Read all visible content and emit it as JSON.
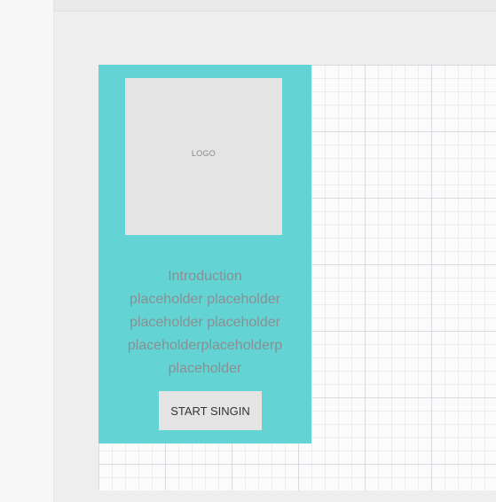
{
  "screen": {
    "logo_placeholder": "LOGO",
    "intro_lines": [
      "Introduction",
      "placeholder placeholder",
      "placeholder placeholder",
      "placeholderplaceholderp",
      "placeholder"
    ],
    "start_button_label": "START SINGIN"
  },
  "colors": {
    "screen_background": "#63d3d3",
    "placeholder_gray": "#e4e4e4",
    "intro_text": "#8b8f93"
  }
}
